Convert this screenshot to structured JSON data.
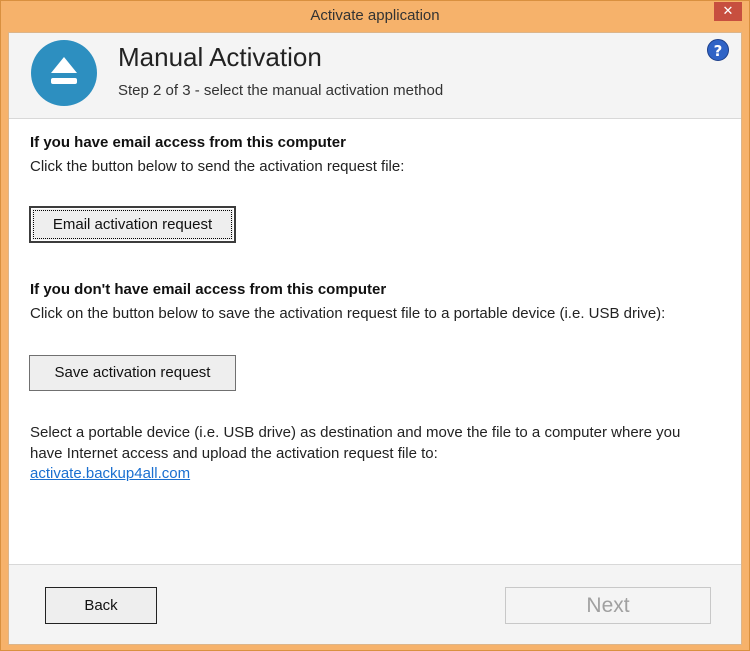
{
  "window": {
    "title": "Activate application",
    "close_glyph": "✕"
  },
  "header": {
    "title": "Manual Activation",
    "subtitle": "Step 2 of 3 - select the manual activation method",
    "logo_icon": "eject-icon",
    "help_glyph": "?"
  },
  "email_section": {
    "heading": "If you have email access from this computer",
    "text": "Click the button below to send the activation request file:",
    "button_label": "Email activation request"
  },
  "save_section": {
    "heading": "If you don't have email access from this computer",
    "text": "Click on the button below to save the activation request file to a portable device (i.e. USB drive):",
    "button_label": "Save activation request"
  },
  "instructions": {
    "line1": "Select a portable device (i.e. USB drive) as destination and move the file to a computer where you",
    "line2": "have Internet access and upload the activation request file to:",
    "link": "activate.backup4all.com"
  },
  "footer": {
    "back_label": "Back",
    "next_label": "Next",
    "next_enabled": false
  },
  "colors": {
    "titlebar": "#f6b26b",
    "close": "#c74f3f",
    "logo": "#2d8fc0",
    "link": "#1a6fd0"
  }
}
